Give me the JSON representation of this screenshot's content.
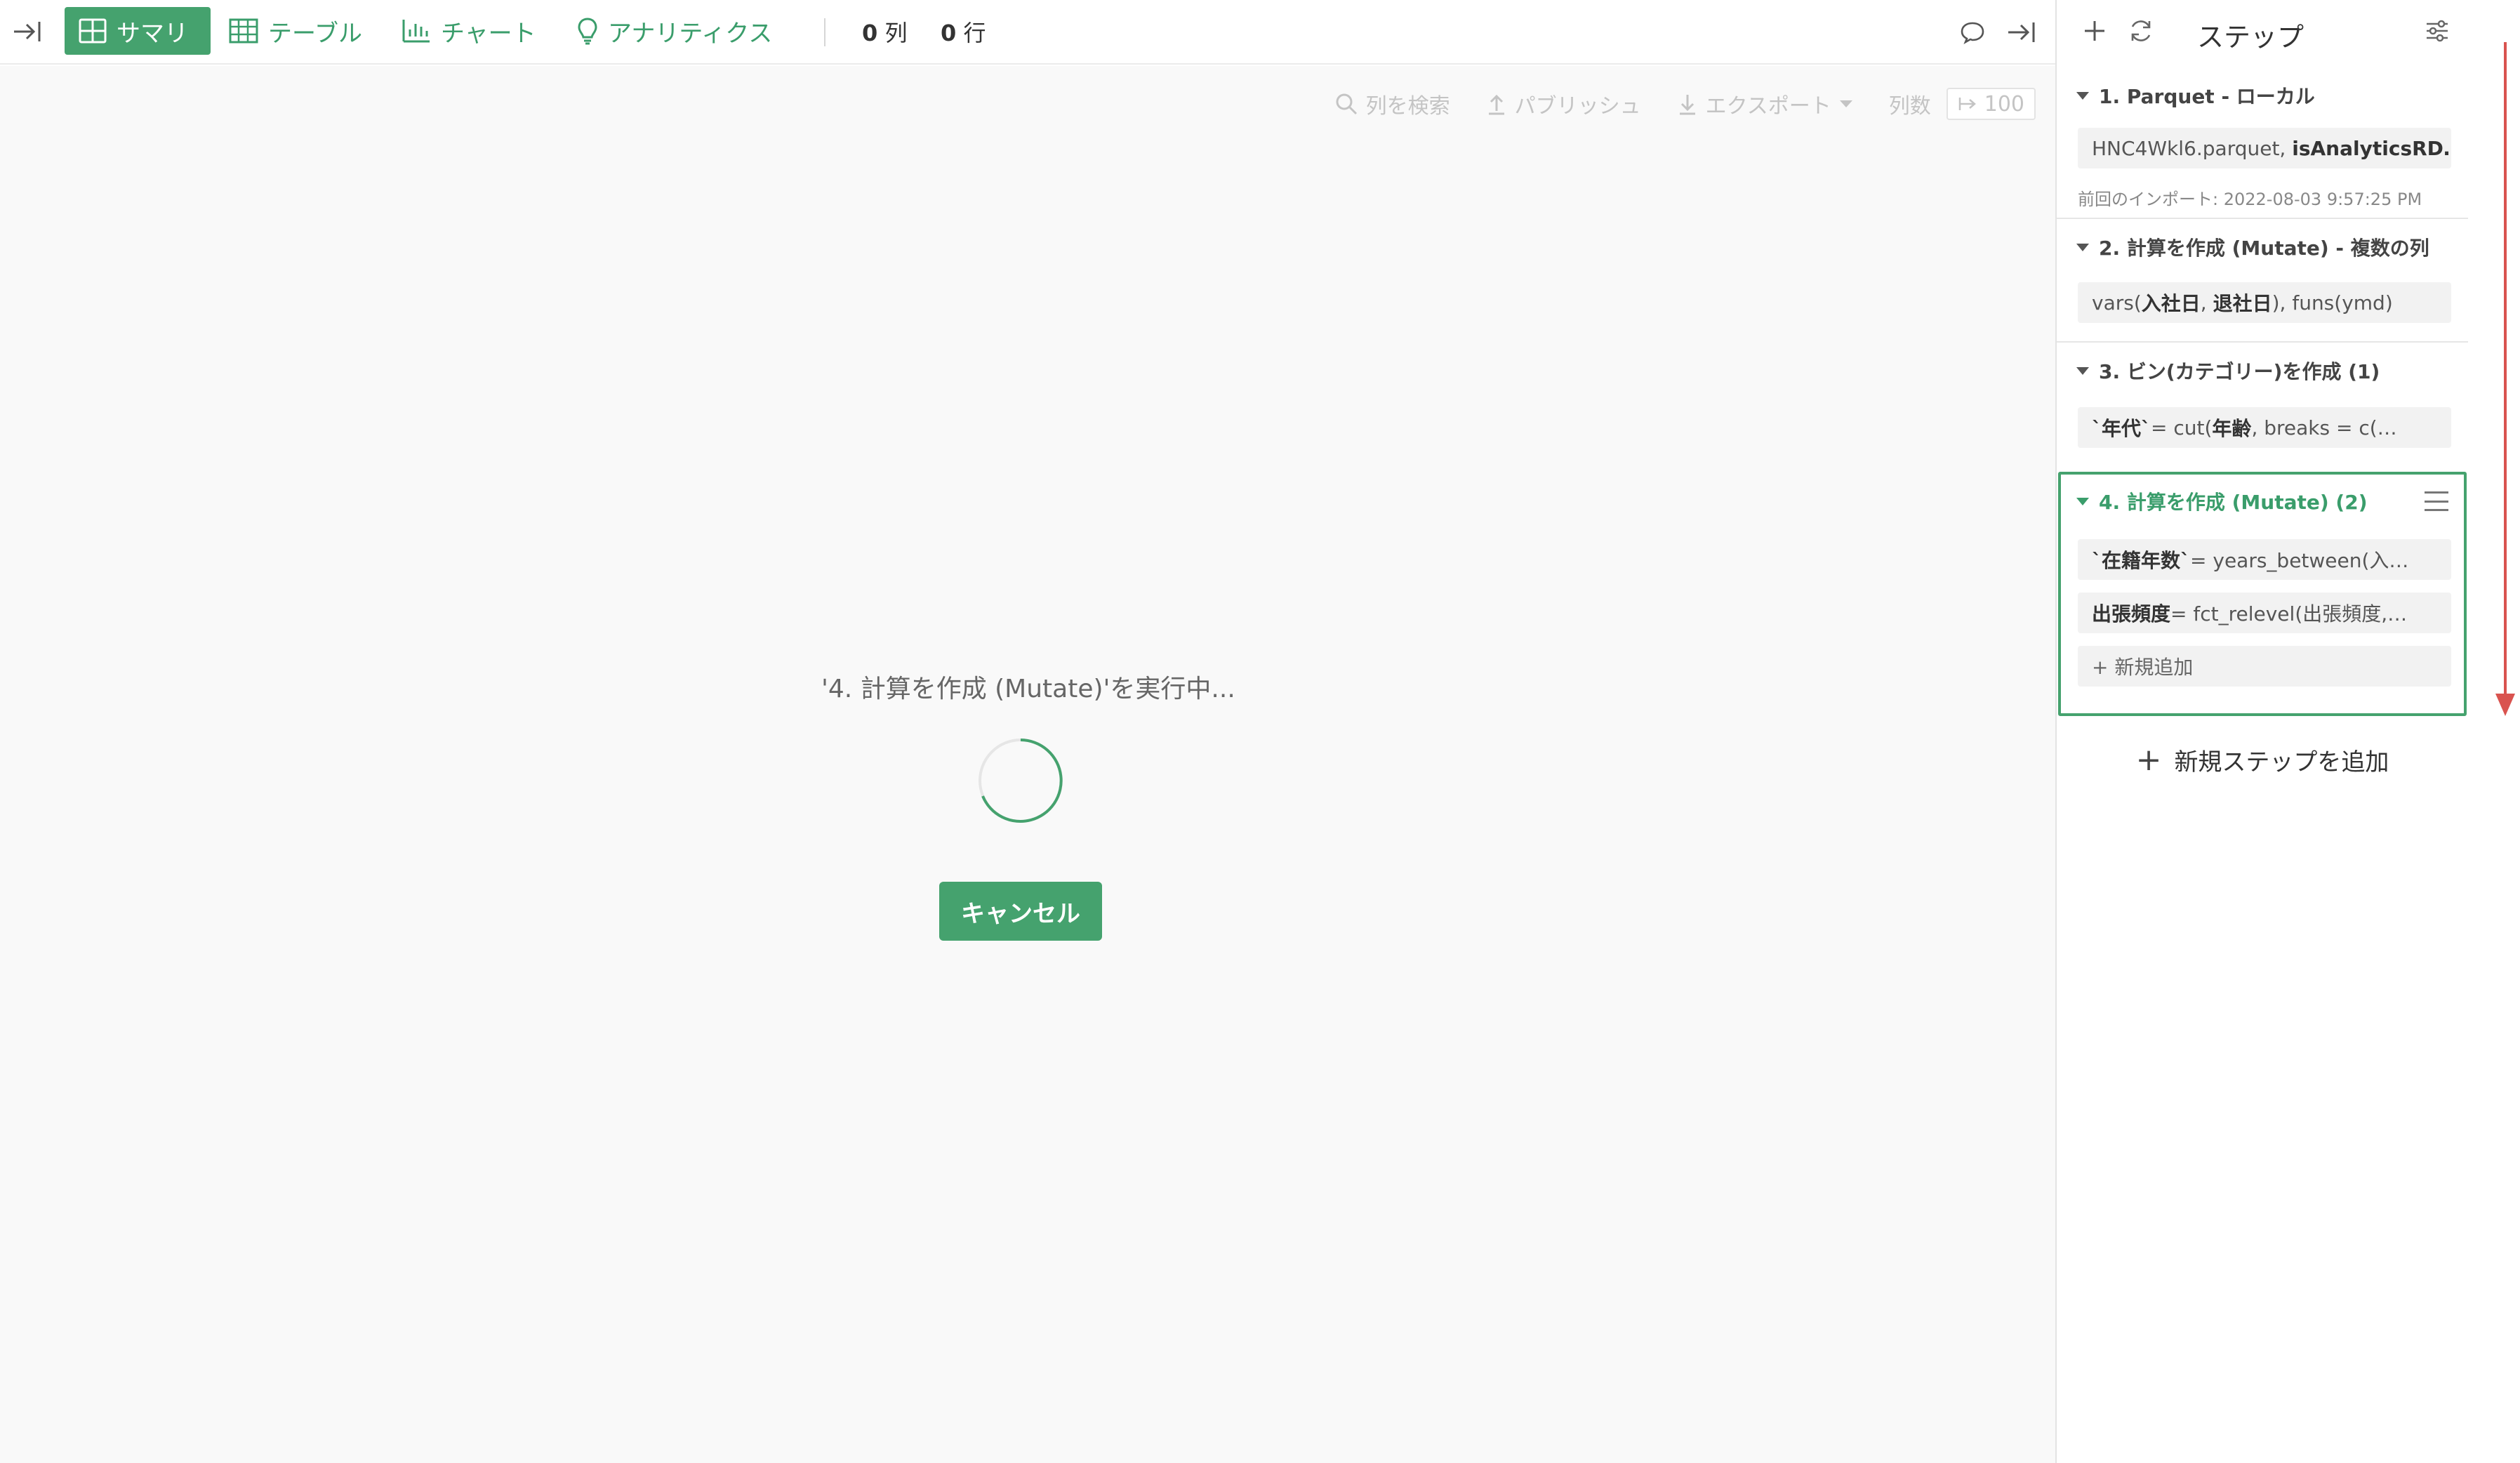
{
  "toolbar": {
    "tabs": [
      {
        "label": "サマリ",
        "icon": "summary-grid-icon"
      },
      {
        "label": "テーブル",
        "icon": "table-icon"
      },
      {
        "label": "チャート",
        "icon": "bar-chart-icon"
      },
      {
        "label": "アナリティクス",
        "icon": "lightbulb-icon"
      }
    ],
    "cols_count": "0",
    "cols_unit": "列",
    "rows_count": "0",
    "rows_unit": "行"
  },
  "main": {
    "search_label": "列を検索",
    "publish_label": "パブリッシュ",
    "export_label": "エクスポート",
    "cols_label": "列数",
    "limit_value": "100",
    "running_text": "'4. 計算を作成 (Mutate)'を実行中...",
    "cancel_label": "キャンセル"
  },
  "panel": {
    "title": "ステップ",
    "steps": [
      {
        "title": "1. Parquet - ローカル",
        "chip_plain": "HNC4Wkl6.parquet, ",
        "chip_bold": "isAnalyticsRD…",
        "meta": "前回のインポート: 2022-08-03 9:57:25 PM"
      },
      {
        "title": "2. 計算を作成 (Mutate) - 複数の列",
        "chip_plain_1": "vars(",
        "chip_bold_1": "入社日",
        "chip_plain_2": ", ",
        "chip_bold_2": "退社日",
        "chip_plain_3": "), funs(ymd)"
      },
      {
        "title": "3. ビン(カテゴリー)を作成 (1)",
        "chip_bold_1": "`年代`",
        "chip_plain_1": " = cut(",
        "chip_bold_2": "年齢",
        "chip_plain_2": ", breaks = c(…"
      },
      {
        "title": "4. 計算を作成 (Mutate) (2)",
        "chip1_bold": "`在籍年数`",
        "chip1_plain": " = years_between(入…",
        "chip2_bold": "出張頻度",
        "chip2_plain": " = fct_relevel(出張頻度,…",
        "add_new": "+ 新規追加"
      }
    ],
    "add_step_label": "新規ステップを追加"
  },
  "colors": {
    "accent": "#45a26e",
    "scroll_arrow": "#d9534f"
  }
}
